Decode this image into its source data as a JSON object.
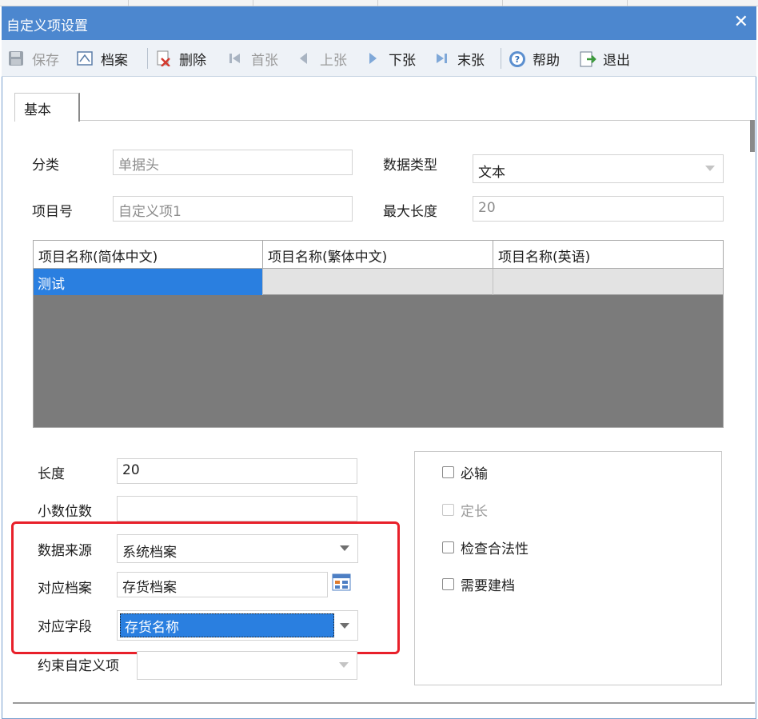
{
  "window": {
    "title": "自定义项设置",
    "close_glyph": "✕"
  },
  "toolbar": {
    "save": "保存",
    "archive": "档案",
    "delete": "删除",
    "first": "首张",
    "prev": "上张",
    "next": "下张",
    "last": "末张",
    "help": "帮助",
    "exit": "退出"
  },
  "tabs": [
    {
      "label": "基本",
      "active": true
    }
  ],
  "form": {
    "category": {
      "label": "分类",
      "value": "单据头"
    },
    "data_type": {
      "label": "数据类型",
      "value": "文本"
    },
    "item_no": {
      "label": "项目号",
      "value": "自定义项1"
    },
    "max_length": {
      "label": "最大长度",
      "value": "20"
    },
    "length": {
      "label": "长度",
      "value": "20"
    },
    "decimals": {
      "label": "小数位数",
      "value": ""
    },
    "data_source": {
      "label": "数据来源",
      "value": "系统档案"
    },
    "linked_archive": {
      "label": "对应档案",
      "value": "存货档案"
    },
    "linked_field": {
      "label": "对应字段",
      "value": "存货名称"
    },
    "constraint_item": {
      "label": "约束自定义项",
      "value": ""
    }
  },
  "grid": {
    "columns": [
      "项目名称(简体中文)",
      "项目名称(繁体中文)",
      "项目名称(英语)"
    ],
    "rows": [
      [
        "测试",
        "",
        ""
      ]
    ]
  },
  "options": {
    "required": {
      "label": "必输",
      "checked": false,
      "enabled": true
    },
    "fixed_length": {
      "label": "定长",
      "checked": false,
      "enabled": false
    },
    "check_validity": {
      "label": "检查合法性",
      "checked": false,
      "enabled": true
    },
    "need_archive": {
      "label": "需要建档",
      "checked": false,
      "enabled": true
    }
  },
  "colors": {
    "titlebar": "#4c87cf",
    "selection": "#2a7fe0",
    "highlight_border": "#e8202a"
  }
}
